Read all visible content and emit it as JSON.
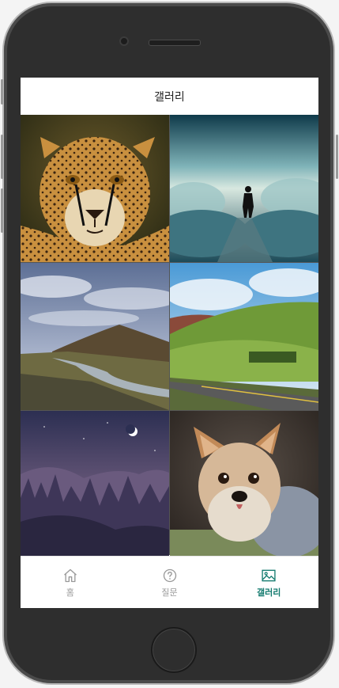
{
  "header": {
    "title": "갤러리"
  },
  "gallery": {
    "images": [
      {
        "name": "cheetah"
      },
      {
        "name": "man-walking-clouds"
      },
      {
        "name": "mountain-river"
      },
      {
        "name": "green-hills-road"
      },
      {
        "name": "night-mountains-moon"
      },
      {
        "name": "yorkshire-terrier"
      }
    ]
  },
  "tabbar": {
    "items": [
      {
        "label": "홈",
        "icon": "home-icon"
      },
      {
        "label": "질문",
        "icon": "question-circle-icon"
      },
      {
        "label": "갤러리",
        "icon": "image-icon",
        "active": true
      }
    ],
    "active_color": "#127a6e",
    "inactive_color": "#999999"
  }
}
